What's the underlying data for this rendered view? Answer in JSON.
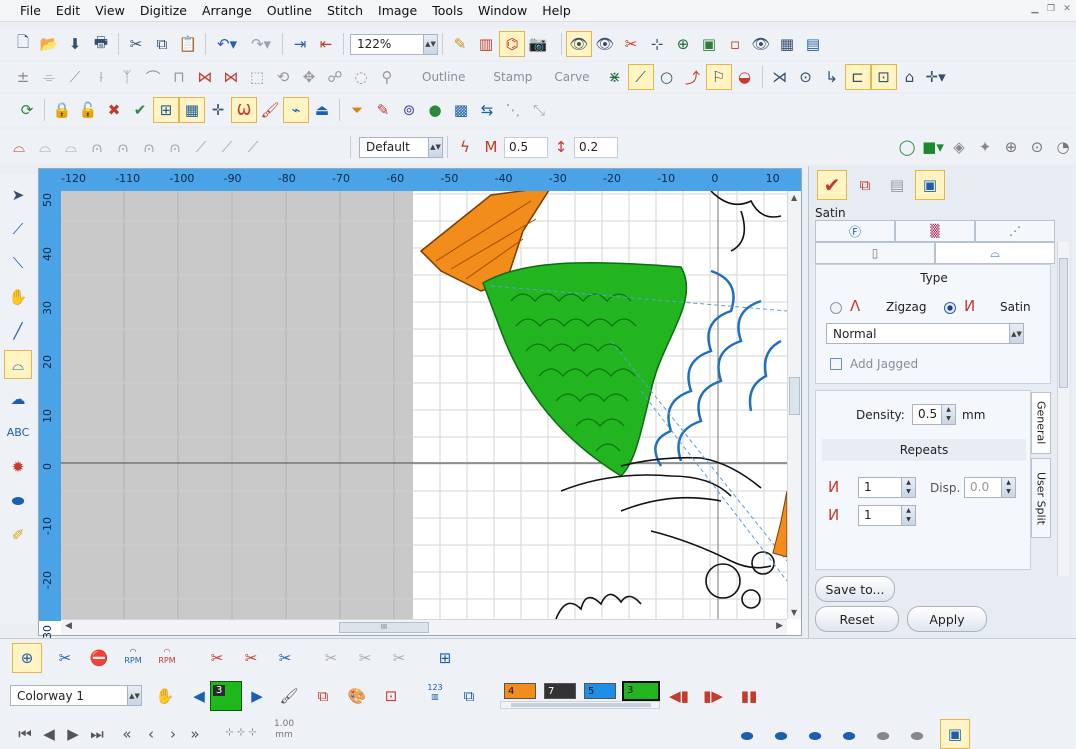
{
  "menu": [
    "File",
    "Edit",
    "View",
    "Digitize",
    "Arrange",
    "Outline",
    "Stitch",
    "Image",
    "Tools",
    "Window",
    "Help"
  ],
  "toolbar": {
    "zoom": "122%",
    "outline_label": "Outline",
    "stamp_label": "Stamp",
    "carve_label": "Carve",
    "style": "Default",
    "value_a": "0.5",
    "value_b": "0.2"
  },
  "ruler": {
    "top": [
      "-120",
      "-110",
      "-100",
      "-90",
      "-80",
      "-70",
      "-60",
      "-50",
      "-40",
      "-30",
      "-20",
      "-10",
      "0",
      "10"
    ],
    "left": [
      "50",
      "40",
      "30",
      "20",
      "10",
      "0",
      "-10",
      "-20",
      "-30"
    ]
  },
  "scroll": {
    "h_grip": "III"
  },
  "panel": {
    "stitch_type": "Satin",
    "type_heading": "Type",
    "zigzag": "Zigzag",
    "satin": "Satin",
    "mode": "Normal",
    "add_jagged": "Add Jagged",
    "density_label": "Density:",
    "density": "0.5",
    "density_unit": "mm",
    "repeats_heading": "Repeats",
    "repeat1": "1",
    "repeat2": "1",
    "disp_label": "Disp.",
    "disp": "0.0",
    "tab_general": "General",
    "tab_user_split": "User Split",
    "save_to": "Save to...",
    "reset": "Reset",
    "apply": "Apply"
  },
  "bottom": {
    "colorway": "Colorway 1",
    "current_color": "3",
    "rpm_label": "RPM",
    "num_123": "123",
    "slider_a": "1.00",
    "slider_b": "mm",
    "palette": [
      {
        "num": "4",
        "color": "#f28c1a"
      },
      {
        "num": "7",
        "color": "#333333"
      },
      {
        "num": "5",
        "color": "#1f8ee8"
      },
      {
        "num": "3",
        "color": "#22b520"
      }
    ]
  },
  "colors": {
    "ruler": "#4aa3e6",
    "orange": "#f28c1a",
    "green": "#22b520",
    "blue": "#1f6fbf"
  }
}
